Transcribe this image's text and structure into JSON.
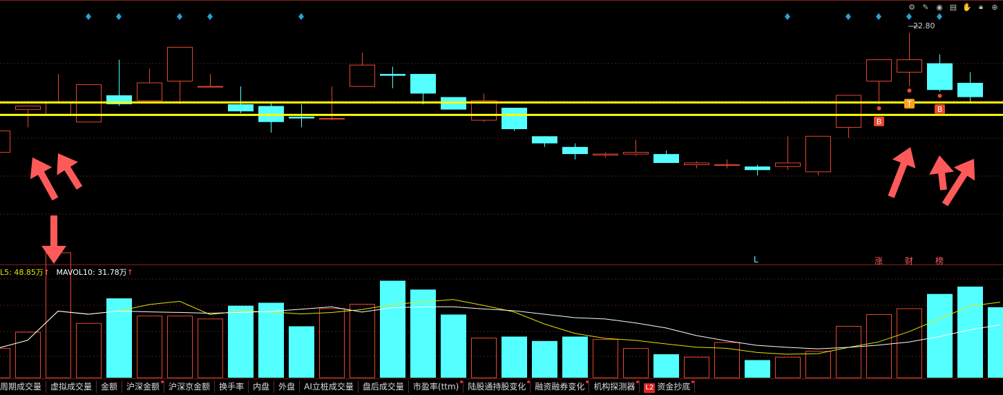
{
  "toolbar": {
    "icons": [
      "gear-icon",
      "pencil-icon",
      "eye-icon",
      "print-icon",
      "hand-icon",
      "lock-icon",
      "plus-icon"
    ]
  },
  "colors": {
    "up": "#e8472e",
    "down": "#54ffff",
    "ma5": "#e6e600",
    "ma10": "#ffffff",
    "support_line": "#ffff00",
    "arrow": "#ff5a5a",
    "marker": "#2aa0d0",
    "badge": "#e8472e",
    "badge_t": "#ff9f1a"
  },
  "price_label": "22.80",
  "mavol": {
    "ma5_text": "L5: 48.85万",
    "ma10_text": "MAVOL10: 31.78万",
    "arrow": "↑"
  },
  "events": {
    "l": "L",
    "zhang": "涨",
    "cai": "财",
    "bang": "榜"
  },
  "signals": [
    {
      "label": "B",
      "candle": 29
    },
    {
      "label": "T",
      "candle": 30
    },
    {
      "label": "B",
      "candle": 31
    }
  ],
  "tabs": [
    {
      "label": "周期成交量",
      "dot": false
    },
    {
      "label": "虚拟成交量",
      "dot": false
    },
    {
      "label": "金额",
      "dot": false
    },
    {
      "label": "沪深金额",
      "dot": true
    },
    {
      "label": "沪深京金额",
      "dot": false
    },
    {
      "label": "换手率",
      "dot": false
    },
    {
      "label": "内盘",
      "dot": false
    },
    {
      "label": "外盘",
      "dot": false
    },
    {
      "label": "AI立桩成交量",
      "dot": false
    },
    {
      "label": "盘后成交量",
      "dot": false
    },
    {
      "label": "市盈率(ttm)",
      "dot": true
    },
    {
      "label": "陆股通持股变化",
      "dot": true
    },
    {
      "label": "融资融券变化",
      "dot": true
    },
    {
      "label": "机构探测器",
      "dot": true
    },
    {
      "label": "资金抄底",
      "dot": true,
      "badge": "L2"
    }
  ],
  "chart_data": {
    "type": "candlestick",
    "y_range": [
      16.5,
      23.6
    ],
    "support_levels": [
      20.8,
      20.45
    ],
    "candles": [
      {
        "o": 19.4,
        "c": 20.0,
        "h": 20.05,
        "l": 19.4
      },
      {
        "o": 20.6,
        "c": 20.7,
        "h": 20.7,
        "l": 20.1
      },
      {
        "o": 20.45,
        "c": 20.8,
        "h": 21.6,
        "l": 20.45
      },
      {
        "o": 20.25,
        "c": 21.3,
        "h": 21.3,
        "l": 20.25
      },
      {
        "o": 21.0,
        "c": 20.75,
        "h": 22.0,
        "l": 20.7
      },
      {
        "o": 20.85,
        "c": 21.35,
        "h": 21.75,
        "l": 20.85
      },
      {
        "o": 21.4,
        "c": 22.35,
        "h": 22.35,
        "l": 20.75
      },
      {
        "o": 21.25,
        "c": 21.25,
        "h": 21.6,
        "l": 21.25
      },
      {
        "o": 20.75,
        "c": 20.55,
        "h": 21.25,
        "l": 20.5
      },
      {
        "o": 20.7,
        "c": 20.25,
        "h": 20.8,
        "l": 19.95
      },
      {
        "o": 20.4,
        "c": 20.35,
        "h": 20.75,
        "l": 20.1
      },
      {
        "o": 20.35,
        "c": 20.35,
        "h": 21.25,
        "l": 20.3
      },
      {
        "o": 21.25,
        "c": 21.85,
        "h": 22.2,
        "l": 21.25
      },
      {
        "o": 21.6,
        "c": 21.55,
        "h": 21.8,
        "l": 21.2
      },
      {
        "o": 21.6,
        "c": 21.05,
        "h": 21.6,
        "l": 20.75
      },
      {
        "o": 20.95,
        "c": 20.6,
        "h": 20.95,
        "l": 20.6
      },
      {
        "o": 20.3,
        "c": 20.85,
        "h": 21.05,
        "l": 20.25
      },
      {
        "o": 20.65,
        "c": 20.05,
        "h": 20.65,
        "l": 20.0
      },
      {
        "o": 19.85,
        "c": 19.65,
        "h": 19.85,
        "l": 19.55
      },
      {
        "o": 19.55,
        "c": 19.35,
        "h": 19.65,
        "l": 19.2
      },
      {
        "o": 19.32,
        "c": 19.35,
        "h": 19.4,
        "l": 19.25
      },
      {
        "o": 19.35,
        "c": 19.4,
        "h": 19.75,
        "l": 19.3
      },
      {
        "o": 19.35,
        "c": 19.1,
        "h": 19.45,
        "l": 19.1
      },
      {
        "o": 19.05,
        "c": 19.1,
        "h": 19.15,
        "l": 18.95
      },
      {
        "o": 19.05,
        "c": 19.05,
        "h": 19.2,
        "l": 18.95
      },
      {
        "o": 19.0,
        "c": 18.9,
        "h": 19.05,
        "l": 18.75
      },
      {
        "o": 19.0,
        "c": 19.1,
        "h": 19.85,
        "l": 18.9
      },
      {
        "o": 18.85,
        "c": 19.85,
        "h": 19.85,
        "l": 18.75
      },
      {
        "o": 20.1,
        "c": 21.0,
        "h": 21.0,
        "l": 19.8
      },
      {
        "o": 21.4,
        "c": 22.0,
        "h": 22.0,
        "l": 20.75
      },
      {
        "o": 21.65,
        "c": 22.0,
        "h": 22.75,
        "l": 21.25
      },
      {
        "o": 21.9,
        "c": 21.15,
        "h": 22.15,
        "l": 21.1
      },
      {
        "o": 21.35,
        "c": 20.95,
        "h": 21.65,
        "l": 20.8
      }
    ],
    "volume": {
      "y_range": [
        0,
        70
      ],
      "values": [
        20,
        31,
        85,
        37,
        54,
        42,
        42,
        40,
        49,
        51,
        35,
        47,
        50,
        66,
        60,
        43,
        27,
        28,
        25,
        28,
        26,
        20,
        16,
        14,
        24,
        12,
        14,
        18,
        35,
        43,
        47,
        57,
        62,
        48
      ]
    }
  }
}
